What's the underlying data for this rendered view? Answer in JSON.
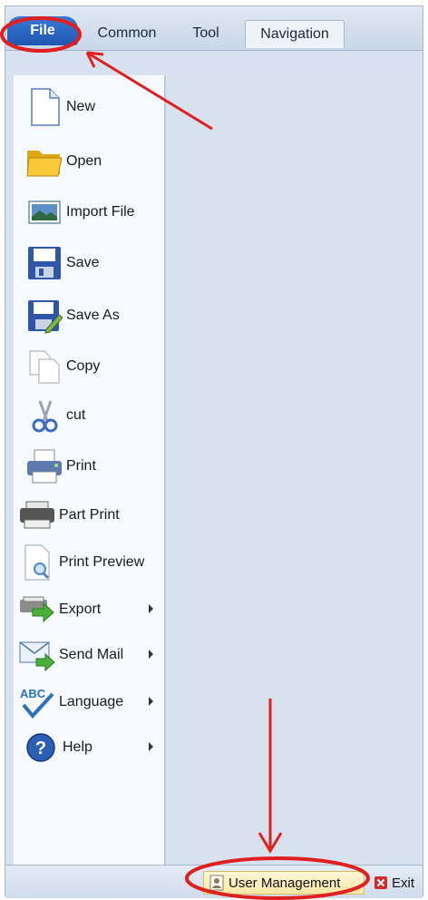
{
  "tabs": [
    {
      "label": "File"
    },
    {
      "label": "Common"
    },
    {
      "label": "Tool"
    },
    {
      "label": "Navigation"
    }
  ],
  "menu": [
    {
      "label": "New",
      "icon": "new-document-icon"
    },
    {
      "label": "Open",
      "icon": "folder-open-icon"
    },
    {
      "label": "Import File",
      "icon": "import-file-icon"
    },
    {
      "label": "Save",
      "icon": "floppy-disk-icon"
    },
    {
      "label": "Save As",
      "icon": "save-as-icon"
    },
    {
      "label": "Copy",
      "icon": "copy-icon"
    },
    {
      "label": "cut",
      "icon": "scissors-icon"
    },
    {
      "label": "Print",
      "icon": "printer-icon"
    },
    {
      "label": "Part Print",
      "icon": "part-print-icon"
    },
    {
      "label": "Print Preview",
      "icon": "print-preview-icon"
    },
    {
      "label": "Export",
      "icon": "export-icon"
    },
    {
      "label": "Send Mail",
      "icon": "mail-icon"
    },
    {
      "label": "Language",
      "icon": "language-abc-icon"
    },
    {
      "label": "Help",
      "icon": "help-icon"
    }
  ],
  "bottom": {
    "user_management": "User Management",
    "exit": "Exit"
  },
  "colors": {
    "file_tab": "#2a66c6",
    "annotation": "#e02020",
    "panel_bg": "#d7e2ee"
  }
}
